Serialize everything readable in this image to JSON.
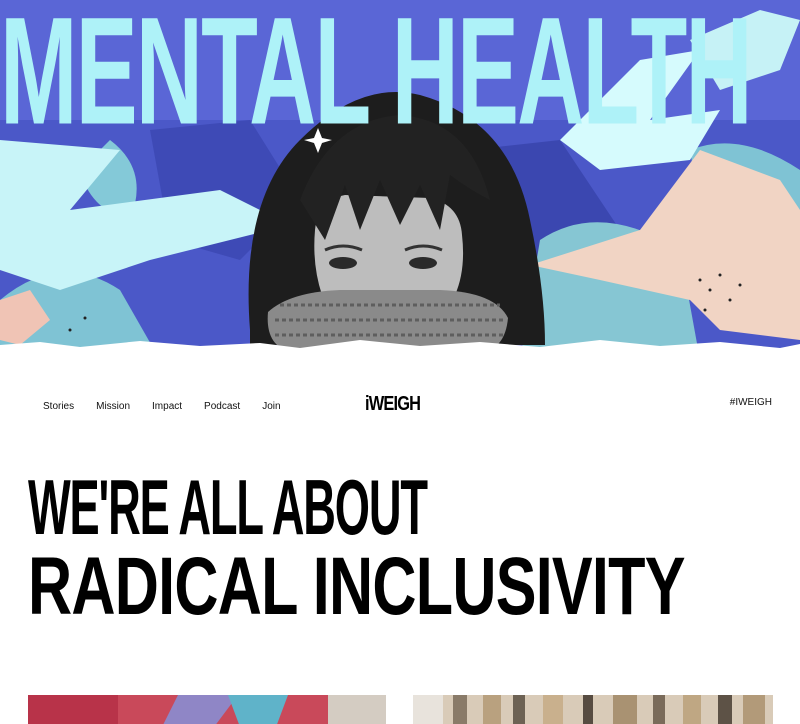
{
  "hero": {
    "title": "MENTAL HEALTH"
  },
  "nav": {
    "links": [
      "Stories",
      "Mission",
      "Impact",
      "Podcast",
      "Join"
    ],
    "logo": "iWEIGH",
    "hashtag": "#IWEIGH"
  },
  "headline": {
    "line1": "WE'RE ALL ABOUT",
    "line2": "RADICAL INCLUSIVITY"
  },
  "colors": {
    "hero_bg": "#4b58c8",
    "hero_title": "#aef2f8",
    "accent_peach": "#f1d4c4",
    "accent_teal": "#7fc3d4"
  }
}
